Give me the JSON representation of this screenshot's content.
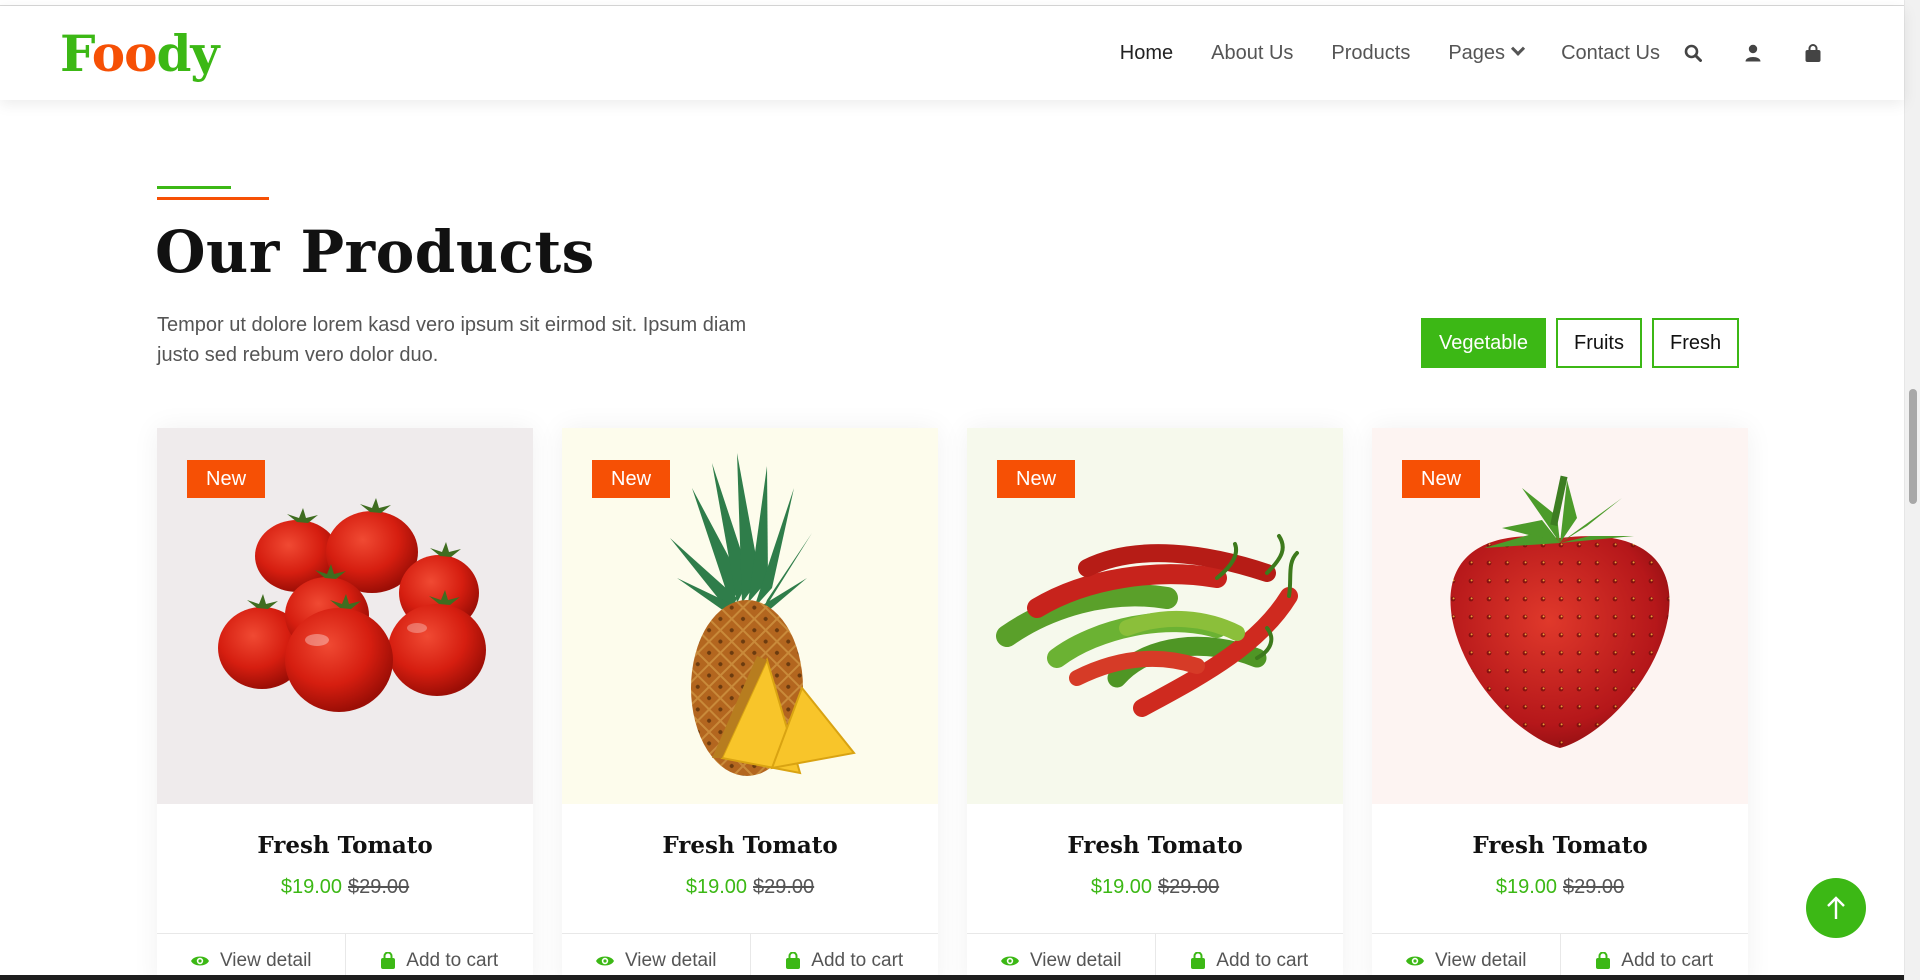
{
  "brand": {
    "part1": "F",
    "part2": "oo",
    "part3": "dy"
  },
  "nav": {
    "items": [
      "Home",
      "About Us",
      "Products",
      "Pages",
      "Contact Us"
    ],
    "icons": [
      "search-icon",
      "user-icon",
      "shopping-bag-icon"
    ]
  },
  "section": {
    "title": "Our Products",
    "description": "Tempor ut dolore lorem kasd vero ipsum sit eirmod sit. Ipsum diam justo sed rebum vero dolor duo."
  },
  "filters": [
    {
      "label": "Vegetable",
      "active": true
    },
    {
      "label": "Fruits",
      "active": false
    },
    {
      "label": "Fresh",
      "active": false
    }
  ],
  "products": [
    {
      "badge": "New",
      "name": "Fresh Tomato",
      "price": "$19.00",
      "old_price": "$29.00",
      "view": "View detail",
      "cart": "Add to cart",
      "bg": "#efebec"
    },
    {
      "badge": "New",
      "name": "Fresh Tomato",
      "price": "$19.00",
      "old_price": "$29.00",
      "view": "View detail",
      "cart": "Add to cart",
      "bg": "#fdfcec"
    },
    {
      "badge": "New",
      "name": "Fresh Tomato",
      "price": "$19.00",
      "old_price": "$29.00",
      "view": "View detail",
      "cart": "Add to cart",
      "bg": "#f6f9ec"
    },
    {
      "badge": "New",
      "name": "Fresh Tomato",
      "price": "$19.00",
      "old_price": "$29.00",
      "view": "View detail",
      "cart": "Add to cart",
      "bg": "#fdf4f2"
    }
  ],
  "colors": {
    "primary": "#3cb815",
    "secondary": "#f65005",
    "dark": "#111111"
  }
}
